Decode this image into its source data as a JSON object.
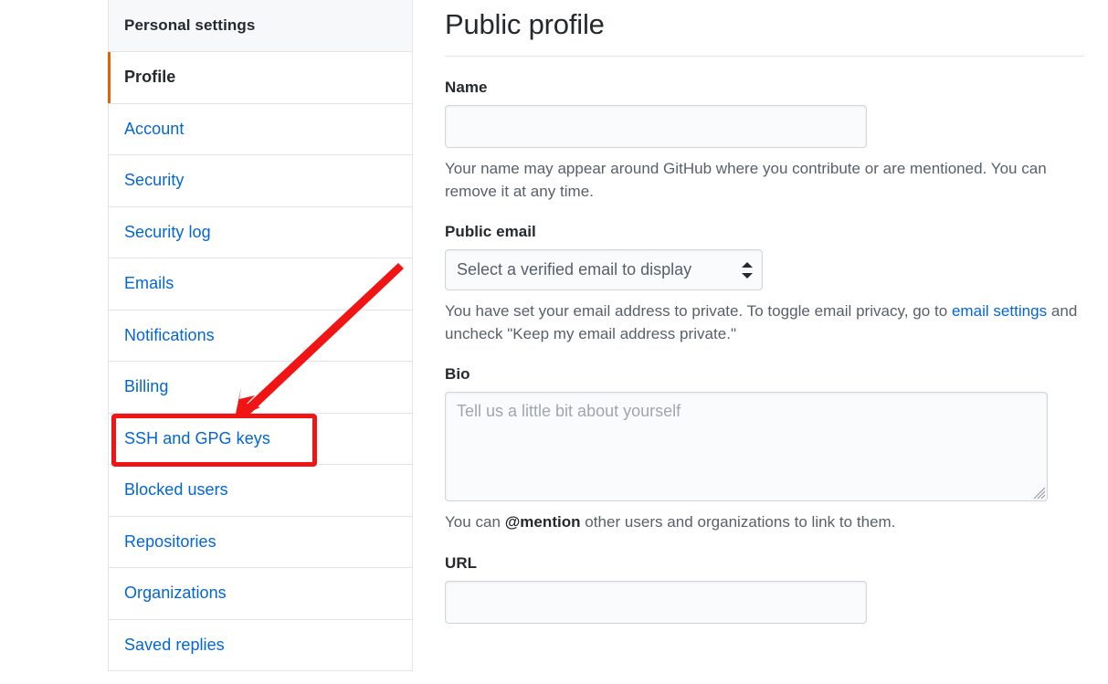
{
  "sidebar": {
    "heading": "Personal settings",
    "items": [
      {
        "label": "Profile",
        "selected": true,
        "highlighted": false
      },
      {
        "label": "Account",
        "selected": false,
        "highlighted": false
      },
      {
        "label": "Security",
        "selected": false,
        "highlighted": false
      },
      {
        "label": "Security log",
        "selected": false,
        "highlighted": false
      },
      {
        "label": "Emails",
        "selected": false,
        "highlighted": false
      },
      {
        "label": "Notifications",
        "selected": false,
        "highlighted": false
      },
      {
        "label": "Billing",
        "selected": false,
        "highlighted": false
      },
      {
        "label": "SSH and GPG keys",
        "selected": false,
        "highlighted": true
      },
      {
        "label": "Blocked users",
        "selected": false,
        "highlighted": false
      },
      {
        "label": "Repositories",
        "selected": false,
        "highlighted": false
      },
      {
        "label": "Organizations",
        "selected": false,
        "highlighted": false
      },
      {
        "label": "Saved replies",
        "selected": false,
        "highlighted": false
      }
    ]
  },
  "main": {
    "title": "Public profile",
    "name": {
      "label": "Name",
      "value": "",
      "placeholder": "",
      "help_text": "Your name may appear around GitHub where you contribute or are mentioned. You can remove it at any time."
    },
    "public_email": {
      "label": "Public email",
      "selected_option": "Select a verified email to display",
      "options": [
        "Select a verified email to display"
      ],
      "help_prefix": "You have set your email address to private. To toggle email privacy, go to ",
      "help_link": "email settings",
      "help_suffix": " and uncheck \"Keep my email address private.\""
    },
    "bio": {
      "label": "Bio",
      "value": "",
      "placeholder": "Tell us a little bit about yourself",
      "help_prefix": "You can ",
      "help_bold": "@mention",
      "help_suffix": " other users and organizations to link to them."
    },
    "url": {
      "label": "URL",
      "value": "",
      "placeholder": ""
    }
  },
  "annotation": {
    "box_target": "SSH and GPG keys",
    "arrow_color": "#f11414",
    "box_color": "#f11414"
  },
  "colors": {
    "link": "#0366d6",
    "accent_selected": "#e36209",
    "text": "#24292e",
    "muted": "#586069",
    "border": "#e1e4e8",
    "input_bg": "#fafbfc",
    "header_bg": "#f6f8fa"
  }
}
